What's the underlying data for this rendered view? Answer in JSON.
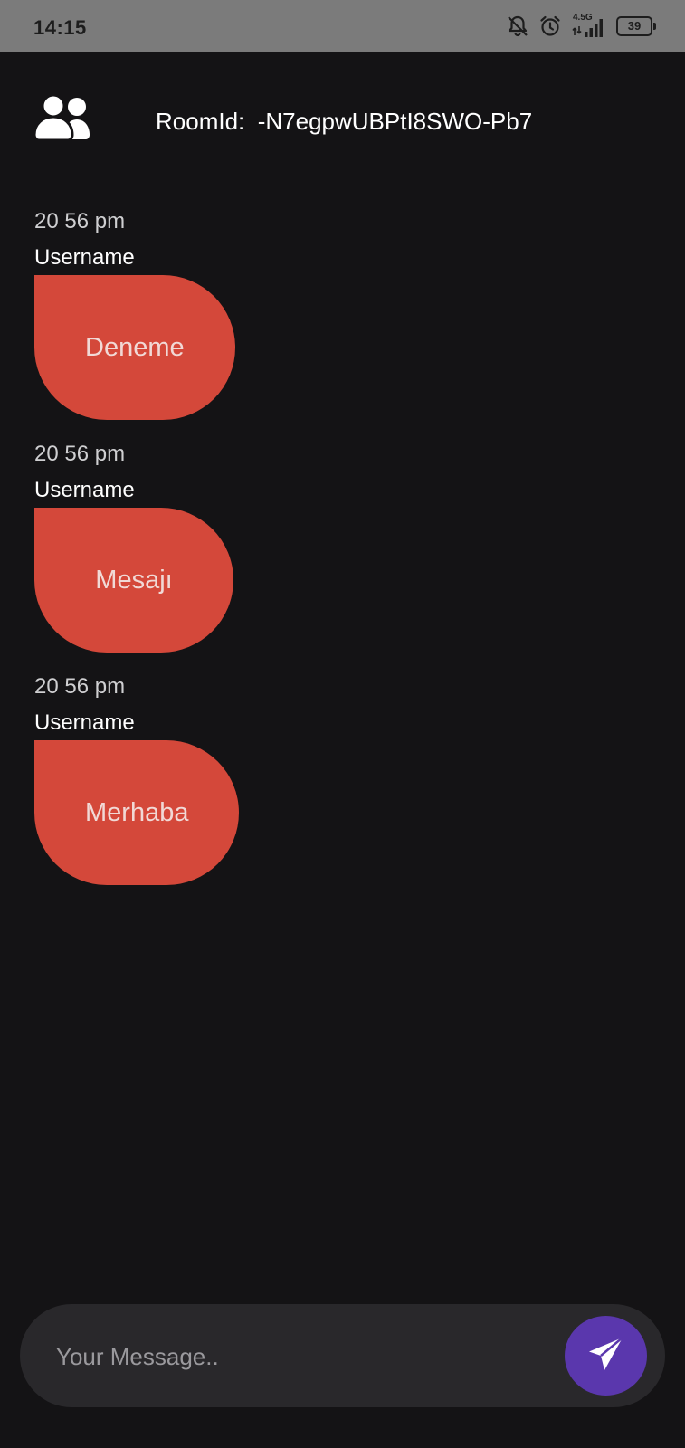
{
  "status_bar": {
    "time": "14:15",
    "network": "4.5G",
    "battery": "39",
    "icons": [
      "muted-bell-icon",
      "alarm-icon",
      "signal-icon",
      "battery-icon"
    ]
  },
  "header": {
    "icon": "users-icon",
    "room_label": "RoomId:  -N7egpwUBPtI8SWO-Pb7"
  },
  "messages": [
    {
      "time": "20 56 pm",
      "username": "Username",
      "text": "Deneme"
    },
    {
      "time": "20 56 pm",
      "username": "Username",
      "text": "Mesajı"
    },
    {
      "time": "20 56 pm",
      "username": "Username",
      "text": "Merhaba"
    }
  ],
  "composer": {
    "placeholder": "Your Message..",
    "value": "",
    "send_icon": "send-icon"
  },
  "colors": {
    "background": "#141315",
    "status_bar": "#7b7b7b",
    "bubble": "#d4483a",
    "composer": "#29282b",
    "send_button": "#5a37ad"
  }
}
